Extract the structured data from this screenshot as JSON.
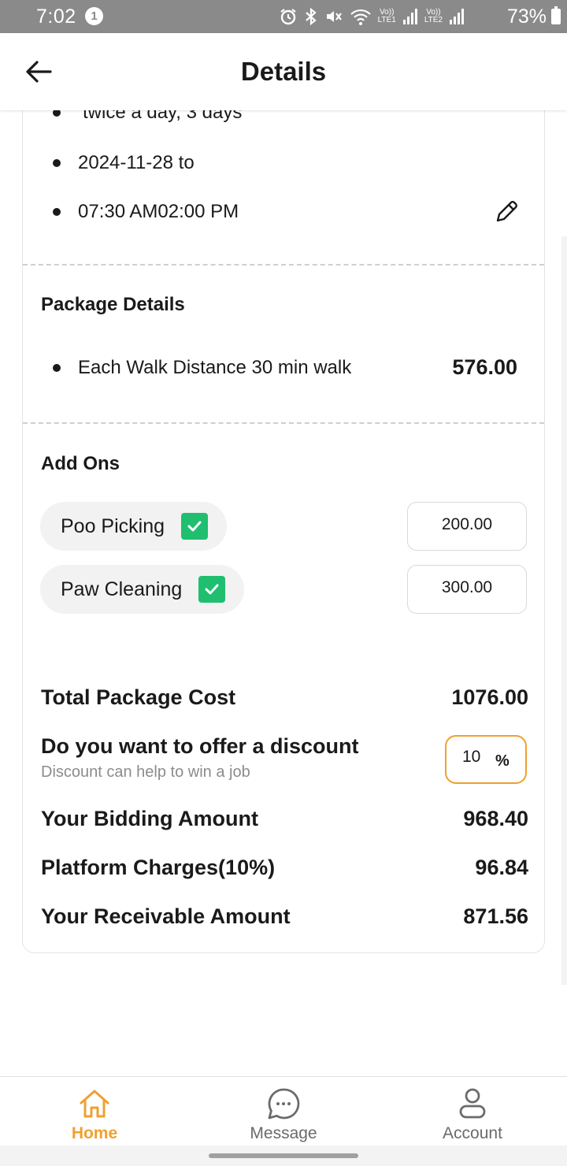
{
  "status_bar": {
    "time": "7:02",
    "notification_count": "1",
    "lte1_label": "Vo))\nLTE1",
    "lte2_label": "Vo))\nLTE2",
    "battery": "73%"
  },
  "header": {
    "title": "Details"
  },
  "schedule": {
    "frequency": "twice a day, 3 days",
    "date_range": "2024-11-28 to",
    "time_range": "07:30 AM02:00 PM"
  },
  "package": {
    "section_title": "Package Details",
    "item_label": "Each Walk Distance 30 min walk",
    "item_price": "576.00"
  },
  "addons": {
    "section_title": "Add Ons",
    "items": [
      {
        "label": "Poo Picking",
        "checked": true,
        "price": "200.00"
      },
      {
        "label": "Paw Cleaning",
        "checked": true,
        "price": "300.00"
      }
    ]
  },
  "summary": {
    "total_label": "Total Package Cost",
    "total_value": "1076.00",
    "discount_label": "Do you want to offer a discount",
    "discount_hint": "Discount can help to win a job",
    "discount_value": "10",
    "discount_unit": "%",
    "bidding_label": "Your Bidding Amount",
    "bidding_value": "968.40",
    "platform_label": "Platform Charges(10%)",
    "platform_value": "96.84",
    "receivable_label": "Your Receivable Amount",
    "receivable_value": "871.56"
  },
  "nav": {
    "items": [
      {
        "label": "Home",
        "icon": "home-icon",
        "active": true
      },
      {
        "label": "Message",
        "icon": "message-icon",
        "active": false
      },
      {
        "label": "Account",
        "icon": "account-icon",
        "active": false
      }
    ]
  },
  "colors": {
    "accent": "#f0a030",
    "check": "#1fbf6f",
    "nav_inactive": "#6b6b6b",
    "status_bar": "#8a8a8a"
  }
}
